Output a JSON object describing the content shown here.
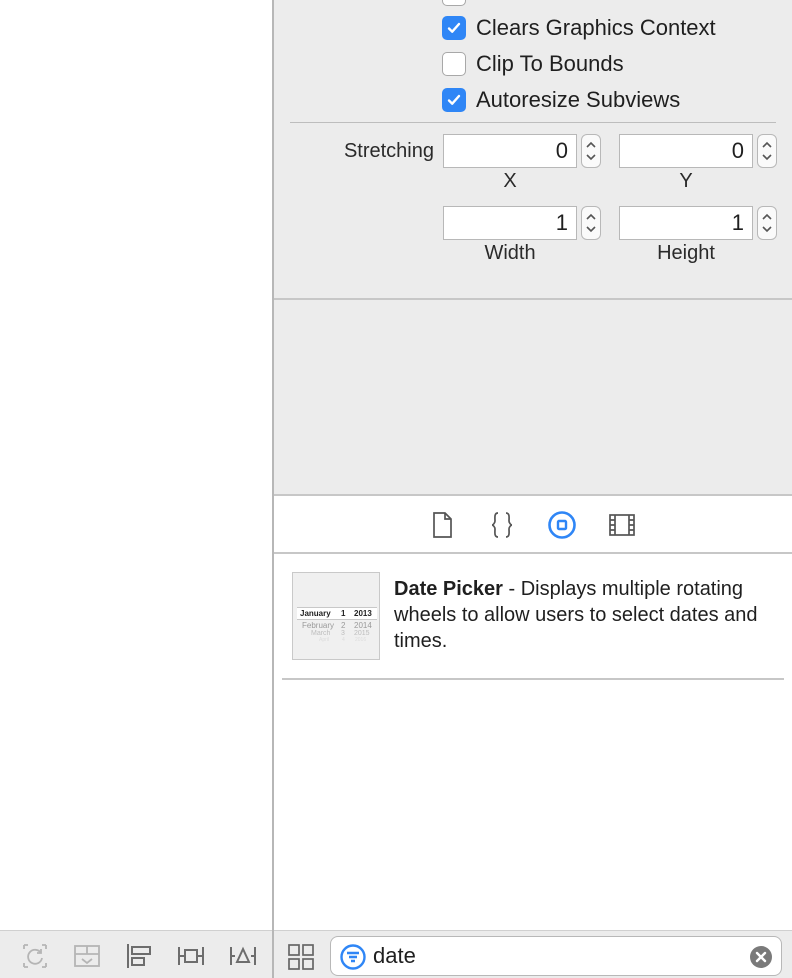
{
  "inspector": {
    "checkboxes": [
      {
        "label": "Clears Graphics Context",
        "checked": true
      },
      {
        "label": "Clip To Bounds",
        "checked": false
      },
      {
        "label": "Autoresize Subviews",
        "checked": true
      }
    ],
    "stretching": {
      "label": "Stretching",
      "x_value": "0",
      "y_value": "0",
      "width_value": "1",
      "height_value": "1",
      "x_caption": "X",
      "y_caption": "Y",
      "width_caption": "Width",
      "height_caption": "Height"
    }
  },
  "library_tabs": [
    {
      "icon": "file-template-icon",
      "selected": false
    },
    {
      "icon": "code-snippet-icon",
      "selected": false
    },
    {
      "icon": "object-library-icon",
      "selected": true
    },
    {
      "icon": "media-library-icon",
      "selected": false
    }
  ],
  "library_item": {
    "title": "Date Picker",
    "description": " - Displays multiple rotating wheels to allow users to select dates and times.",
    "thumbnail_rows": [
      {
        "month": "January",
        "day": "1",
        "year": "2013"
      },
      {
        "month": "February",
        "day": "2",
        "year": "2014"
      },
      {
        "month": "March",
        "day": "3",
        "year": "2015"
      },
      {
        "month": "April",
        "day": "4",
        "year": "2016"
      }
    ]
  },
  "filter": {
    "value": "date"
  },
  "colors": {
    "accent": "#2f86f6",
    "panel_bg": "#ececec",
    "separator": "#c7c7c7"
  }
}
